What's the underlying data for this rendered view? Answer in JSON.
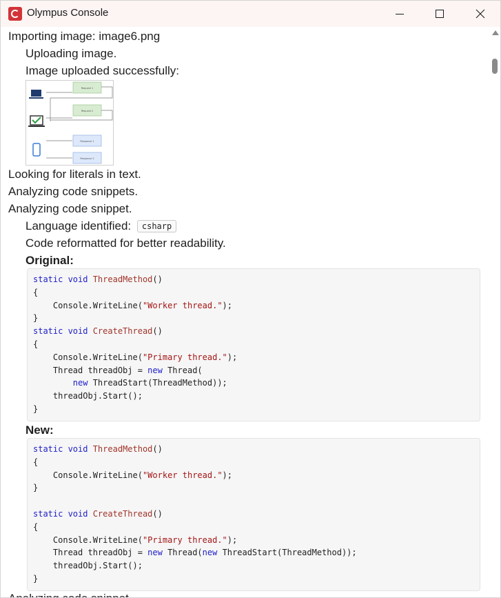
{
  "window": {
    "title": "Olympus Console"
  },
  "log": {
    "importing": "Importing image: image6.png",
    "uploading": "Uploading image.",
    "uploaded": "Image uploaded successfully:",
    "literals": "Looking for literals in text.",
    "analyzing_snippets": "Analyzing code snippets.",
    "analyzing_snippet": "Analyzing code snippet.",
    "language_label": "Language identified:",
    "language_value": "csharp",
    "reformatted": "Code reformatted for better readability.",
    "original_heading": "Original:",
    "new_heading": "New:",
    "trailing": "Analyzing code snippet."
  },
  "thumbnail": {
    "boxes": [
      "Request 1",
      "Request 2",
      "Response 1",
      "Response 2"
    ]
  },
  "code": {
    "original": [
      [
        [
          "kw",
          "static void "
        ],
        [
          "fn",
          "ThreadMethod"
        ],
        [
          "p",
          "()"
        ]
      ],
      [
        [
          "p",
          "{"
        ]
      ],
      [
        [
          "p",
          "    Console.WriteLine("
        ],
        [
          "st",
          "\"Worker thread.\""
        ],
        [
          "p",
          ");"
        ]
      ],
      [
        [
          "p",
          "}"
        ]
      ],
      [
        [
          "kw",
          "static void "
        ],
        [
          "fn",
          "CreateThread"
        ],
        [
          "p",
          "()"
        ]
      ],
      [
        [
          "p",
          "{"
        ]
      ],
      [
        [
          "p",
          "    Console.WriteLine("
        ],
        [
          "st",
          "\"Primary thread.\""
        ],
        [
          "p",
          ");"
        ]
      ],
      [
        [
          "p",
          "    Thread threadObj = "
        ],
        [
          "kw",
          "new"
        ],
        [
          "p",
          " Thread("
        ]
      ],
      [
        [
          "p",
          "        "
        ],
        [
          "kw",
          "new"
        ],
        [
          "p",
          " ThreadStart(ThreadMethod));"
        ]
      ],
      [
        [
          "p",
          "    threadObj.Start();"
        ]
      ],
      [
        [
          "p",
          "}"
        ]
      ]
    ],
    "new": [
      [
        [
          "kw",
          "static void "
        ],
        [
          "fn",
          "ThreadMethod"
        ],
        [
          "p",
          "()"
        ]
      ],
      [
        [
          "p",
          "{"
        ]
      ],
      [
        [
          "p",
          "    Console.WriteLine("
        ],
        [
          "st",
          "\"Worker thread.\""
        ],
        [
          "p",
          ");"
        ]
      ],
      [
        [
          "p",
          "}"
        ]
      ],
      [
        [
          "p",
          ""
        ]
      ],
      [
        [
          "kw",
          "static void "
        ],
        [
          "fn",
          "CreateThread"
        ],
        [
          "p",
          "()"
        ]
      ],
      [
        [
          "p",
          "{"
        ]
      ],
      [
        [
          "p",
          "    Console.WriteLine("
        ],
        [
          "st",
          "\"Primary thread.\""
        ],
        [
          "p",
          ");"
        ]
      ],
      [
        [
          "p",
          "    Thread threadObj = "
        ],
        [
          "kw",
          "new"
        ],
        [
          "p",
          " Thread("
        ],
        [
          "kw",
          "new"
        ],
        [
          "p",
          " ThreadStart(ThreadMethod));"
        ]
      ],
      [
        [
          "p",
          "    threadObj.Start();"
        ]
      ],
      [
        [
          "p",
          "}"
        ]
      ]
    ]
  },
  "colors": {
    "app_icon": "#d13438",
    "keyword": "#2020c8",
    "function": "#a0342a",
    "string": "#a31515"
  }
}
